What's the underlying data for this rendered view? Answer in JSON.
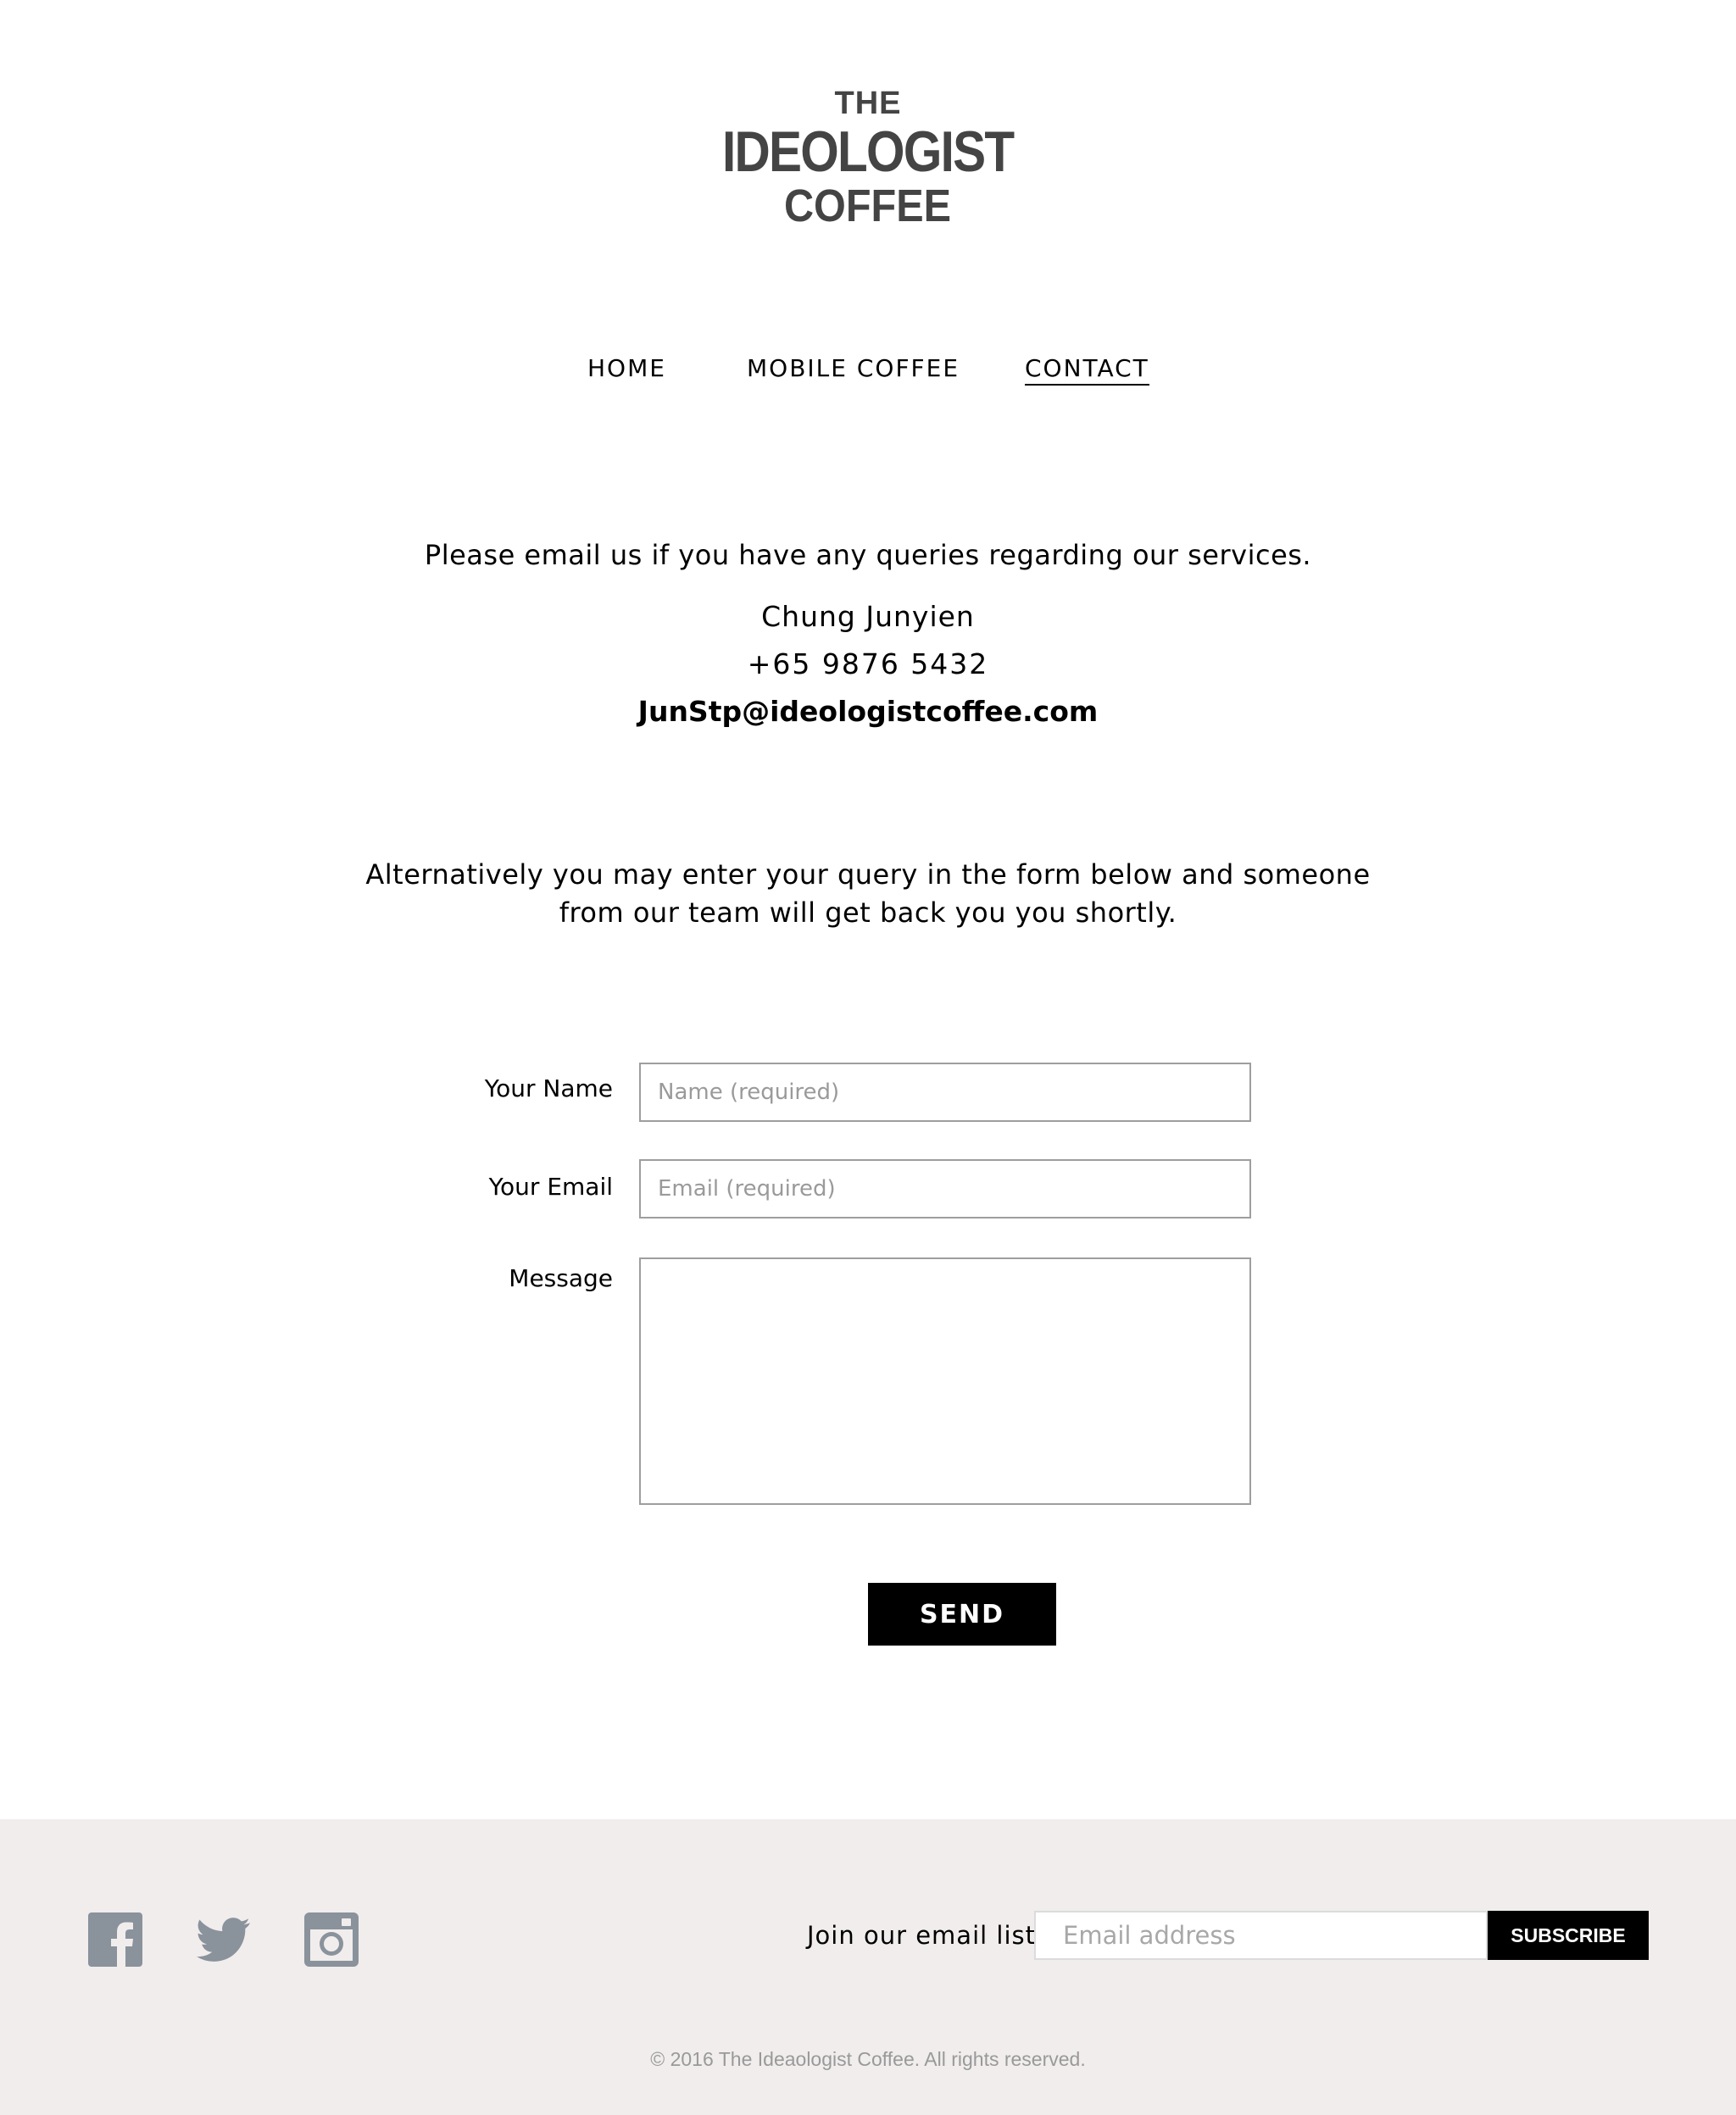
{
  "logo": {
    "line1": "THE",
    "line2": "IDEOLOGIST",
    "line3": "COFFEE"
  },
  "nav": [
    {
      "label": "HOME"
    },
    {
      "label": "MOBILE COFFEE"
    },
    {
      "label": "CONTACT",
      "active": true
    }
  ],
  "contact": {
    "intro": "Please email us if you have any queries regarding our services.",
    "name": "Chung Junyien",
    "phone": "+65 9876 5432",
    "email": "JunStp@ideologistcoffee.com",
    "alternative_line1": "Alternatively you may enter your query in the form below and someone",
    "alternative_line2": "from our team will get back you you shortly."
  },
  "form": {
    "name_label": "Your Name",
    "name_placeholder": "Name (required)",
    "email_label": "Your Email",
    "email_placeholder": "Email (required)",
    "message_label": "Message",
    "message_value": "",
    "send_label": "SEND"
  },
  "footer": {
    "social_icons": [
      "facebook-icon",
      "twitter-icon",
      "instagram-icon"
    ],
    "icon_color": "#8a929c",
    "background": "#f0edec",
    "join_label": "Join our email list",
    "email_placeholder": "Email address",
    "subscribe_label": "SUBSCRIBE",
    "copyright": "© 2016 The Ideaologist Coffee. All rights reserved."
  }
}
